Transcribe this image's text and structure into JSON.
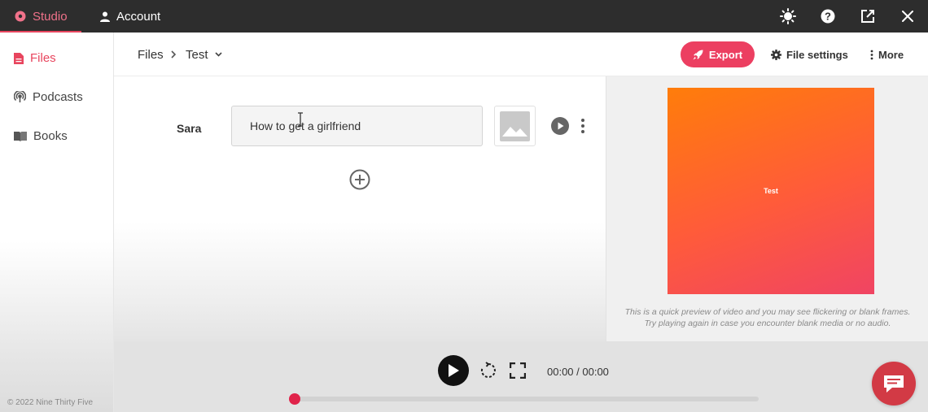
{
  "topbar": {
    "tabs": [
      {
        "label": "Studio",
        "icon": "gear-circle-icon",
        "active": true
      },
      {
        "label": "Account",
        "icon": "user-icon",
        "active": false
      }
    ],
    "icons": [
      "sun-icon",
      "help-icon",
      "open-external-icon",
      "close-icon"
    ]
  },
  "sidebar": {
    "items": [
      {
        "label": "Files",
        "icon": "file-icon",
        "active": true
      },
      {
        "label": "Podcasts",
        "icon": "podcast-icon",
        "active": false
      },
      {
        "label": "Books",
        "icon": "book-icon",
        "active": false
      }
    ],
    "copyright": "© 2022 Nine Thirty Five"
  },
  "header": {
    "breadcrumb": [
      "Files",
      "Test"
    ],
    "export_label": "Export",
    "file_settings_label": "File settings",
    "more_label": "More"
  },
  "editor": {
    "speaker": "Sara",
    "text_value": "How to get a girlfriend"
  },
  "preview": {
    "card_text": "Test",
    "note_line1": "This is a quick preview of video and you may see flickering or blank frames.",
    "note_line2": "Try playing again in case you encounter blank media or no audio."
  },
  "player": {
    "time": "00:00 / 00:00",
    "progress": 0.0
  },
  "colors": {
    "accent": "#ec3f61",
    "topbar": "#2d2d2d",
    "preview_gradient_start": "#ff7d0a",
    "preview_gradient_end": "#f04463"
  }
}
